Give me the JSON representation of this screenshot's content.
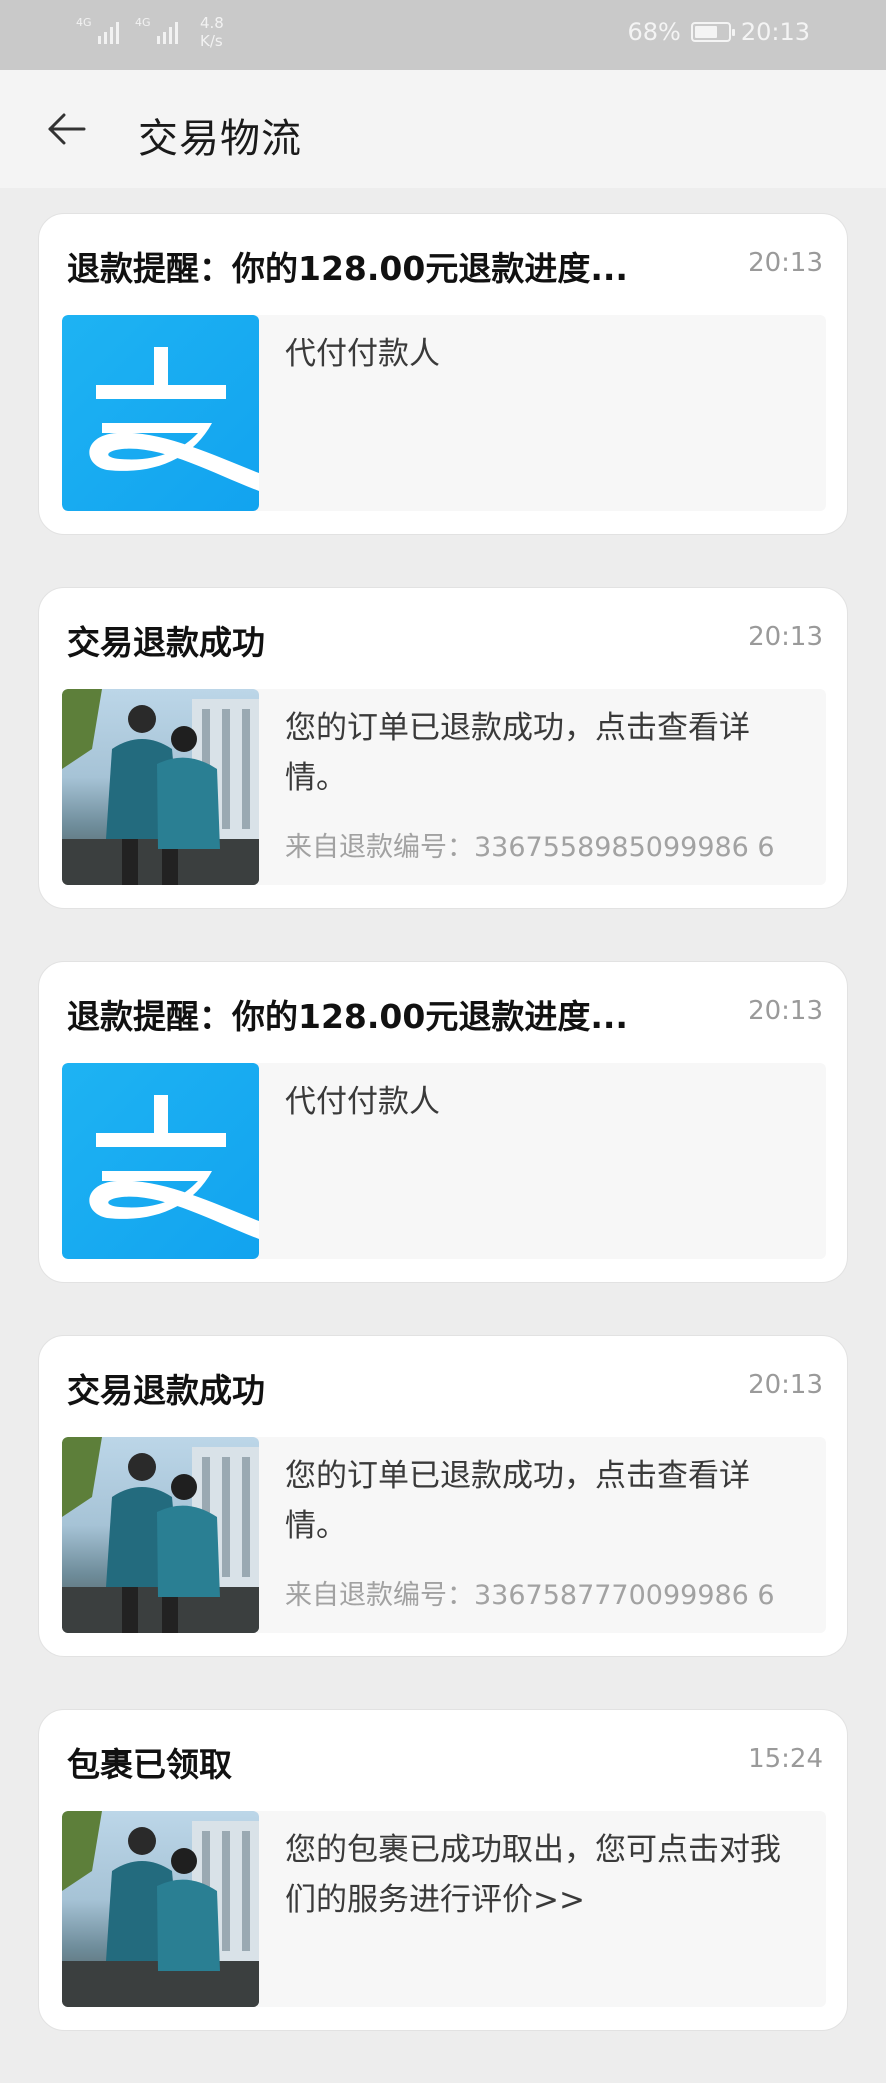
{
  "status_bar": {
    "net1": "4G",
    "net2": "4G",
    "speed_value": "4.8",
    "speed_unit": "K/s",
    "battery": "68%",
    "battery_level": 0.68,
    "time": "20:13"
  },
  "header": {
    "back_icon": "arrow-left-icon",
    "title": "交易物流"
  },
  "messages": [
    {
      "title": "退款提醒：你的128.00元退款进度...",
      "time": "20:13",
      "thumb": "alipay-logo",
      "text": "代付付款人",
      "sub": ""
    },
    {
      "title": "交易退款成功",
      "time": "20:13",
      "thumb": "product-photo",
      "text": "您的订单已退款成功，点击查看详情。",
      "sub": "来自退款编号：3367558985099986 6"
    },
    {
      "title": "退款提醒：你的128.00元退款进度...",
      "time": "20:13",
      "thumb": "alipay-logo",
      "text": "代付付款人",
      "sub": ""
    },
    {
      "title": "交易退款成功",
      "time": "20:13",
      "thumb": "product-photo",
      "text": "您的订单已退款成功，点击查看详情。",
      "sub": "来自退款编号：3367587770099986 6"
    },
    {
      "title": "包裹已领取",
      "time": "15:24",
      "thumb": "product-photo",
      "text": "您的包裹已成功取出，您可点击对我们的服务进行评价>>",
      "sub": ""
    }
  ]
}
